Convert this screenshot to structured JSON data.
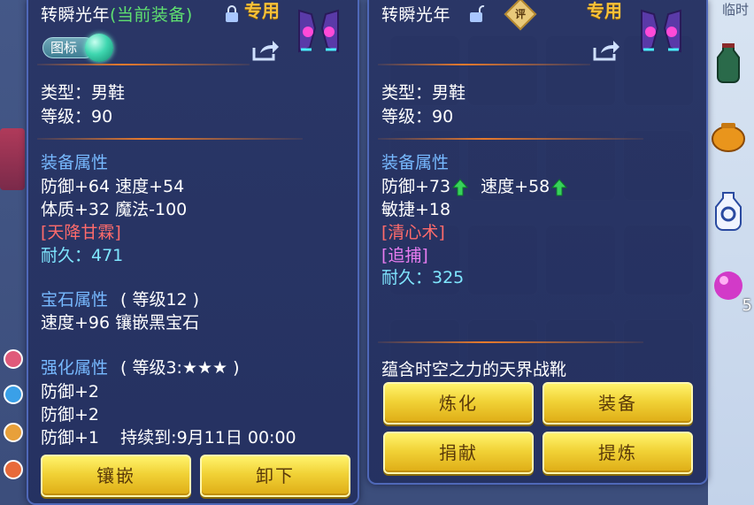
{
  "left_panel": {
    "title_name": "转瞬光年",
    "title_status": "(当前装备)",
    "special_tag": "专用",
    "badge_label": "图标",
    "type_line": "类型：男鞋",
    "level_line": "等级：90",
    "equip_section": "装备属性",
    "stats": [
      "防御+64 速度+54",
      "体质+32 魔法-100"
    ],
    "skill": "[天降甘霖]",
    "durability": "耐久：471",
    "gem_section": "宝石属性",
    "gem_level": "( 等级12 )",
    "gem_line": "速度+96 镶嵌黑宝石",
    "enhance_section": "强化属性",
    "enhance_level": "( 等级3:★★★ )",
    "enhance_lines": [
      "防御+2",
      "防御+2",
      "防御+1    持续到:9月11日 00:00"
    ],
    "buttons": [
      "镶嵌",
      "卸下"
    ]
  },
  "right_panel": {
    "title_name": "转瞬光年",
    "eval_badge": "评",
    "special_tag": "专用",
    "type_line": "类型：男鞋",
    "level_line": "等级：90",
    "equip_section": "装备属性",
    "stat_def": "防御+73",
    "stat_speed": "速度+58",
    "stat_agi": "敏捷+18",
    "skill1": "[清心术]",
    "skill2": "[追捕]",
    "durability": "耐久：325",
    "description": "蕴含时空之力的天界战靴",
    "buttons": [
      "炼化",
      "装备",
      "捐献",
      "提炼"
    ]
  },
  "side": {
    "tag": "临时",
    "count": "5"
  },
  "colors": {
    "section_blue": "#77b9ff",
    "skill_red": "#ff6b6b",
    "skill_pink": "#e77cf0",
    "durability_cyan": "#7fe6ff",
    "status_green": "#5fe070",
    "tag_gold": "#f6c13a",
    "button_gold": "#f1d236"
  },
  "icons": {
    "lock_closed": "lock-icon",
    "lock_open": "unlock-icon",
    "share": "share-icon",
    "boots": "boots-icon",
    "up_arrow": "up-arrow-icon"
  }
}
